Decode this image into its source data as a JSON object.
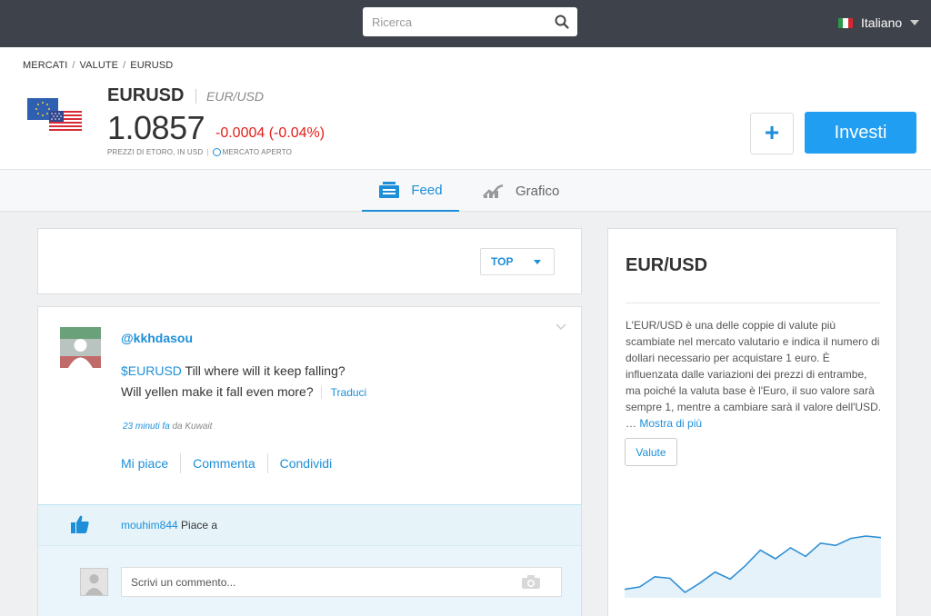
{
  "topbar": {
    "search_placeholder": "Ricerca",
    "language": "Italiano",
    "icons": [
      "search-icon",
      "italy-flag-icon",
      "caret-down-icon"
    ]
  },
  "breadcrumb": {
    "items": [
      "MERCATI",
      "VALUTE",
      "EURUSD"
    ],
    "separator": "/"
  },
  "instrument": {
    "symbol": "EURUSD",
    "name": "EUR/USD",
    "price": "1.0857",
    "change": "-0.0004 (-0.04%)",
    "price_note": "PREZZI DI ETORO, IN USD",
    "market_status": "MERCATO APERTO",
    "add_button": "+",
    "invest_button": "Investi"
  },
  "tabs": [
    {
      "label": "Feed",
      "active": true,
      "icon": "feed-icon"
    },
    {
      "label": "Grafico",
      "active": false,
      "icon": "chart-icon"
    }
  ],
  "feed": {
    "filter_label": "TOP",
    "post": {
      "username": "@kkhdasou",
      "ticker": "$EURUSD",
      "text_1": " Till where will it keep falling?",
      "text_2": "Will yellen make it fall even more?",
      "translate": "Traduci",
      "time": "23 minuti fa",
      "location_prefix": " da ",
      "location": "Kuwait",
      "actions": [
        "Mi piace",
        "Commenta",
        "Condividi"
      ],
      "liker": "mouhim844",
      "liked_text": " Piace a",
      "comment_placeholder": "Scrivi un commento..."
    }
  },
  "sidebar": {
    "title": "EUR/USD",
    "description": "L'EUR/USD è una delle coppie di valute più scambiate nel mercato valutario e indica il numero di dollari necessario per acquistare 1 euro. È influenzata dalle variazioni dei prezzi di entrambe, ma poiché la valuta base è l'Euro, il suo valore sarà sempre 1, mentre a cambiare sarà il valore dell'USD. … ",
    "more_link": "Mostra di più",
    "tag": "Valute",
    "sparkline": [
      1.079,
      1.0793,
      1.0806,
      1.0804,
      1.0786,
      1.0798,
      1.0812,
      1.0803,
      1.082,
      1.084,
      1.0829,
      1.0843,
      1.0832,
      1.0849,
      1.0846,
      1.0855,
      1.0858,
      1.0856
    ]
  },
  "colors": {
    "accent": "#1d8fd8",
    "invest": "#1f9ef2",
    "negative": "#e0201b",
    "topbar": "#3e424a"
  }
}
